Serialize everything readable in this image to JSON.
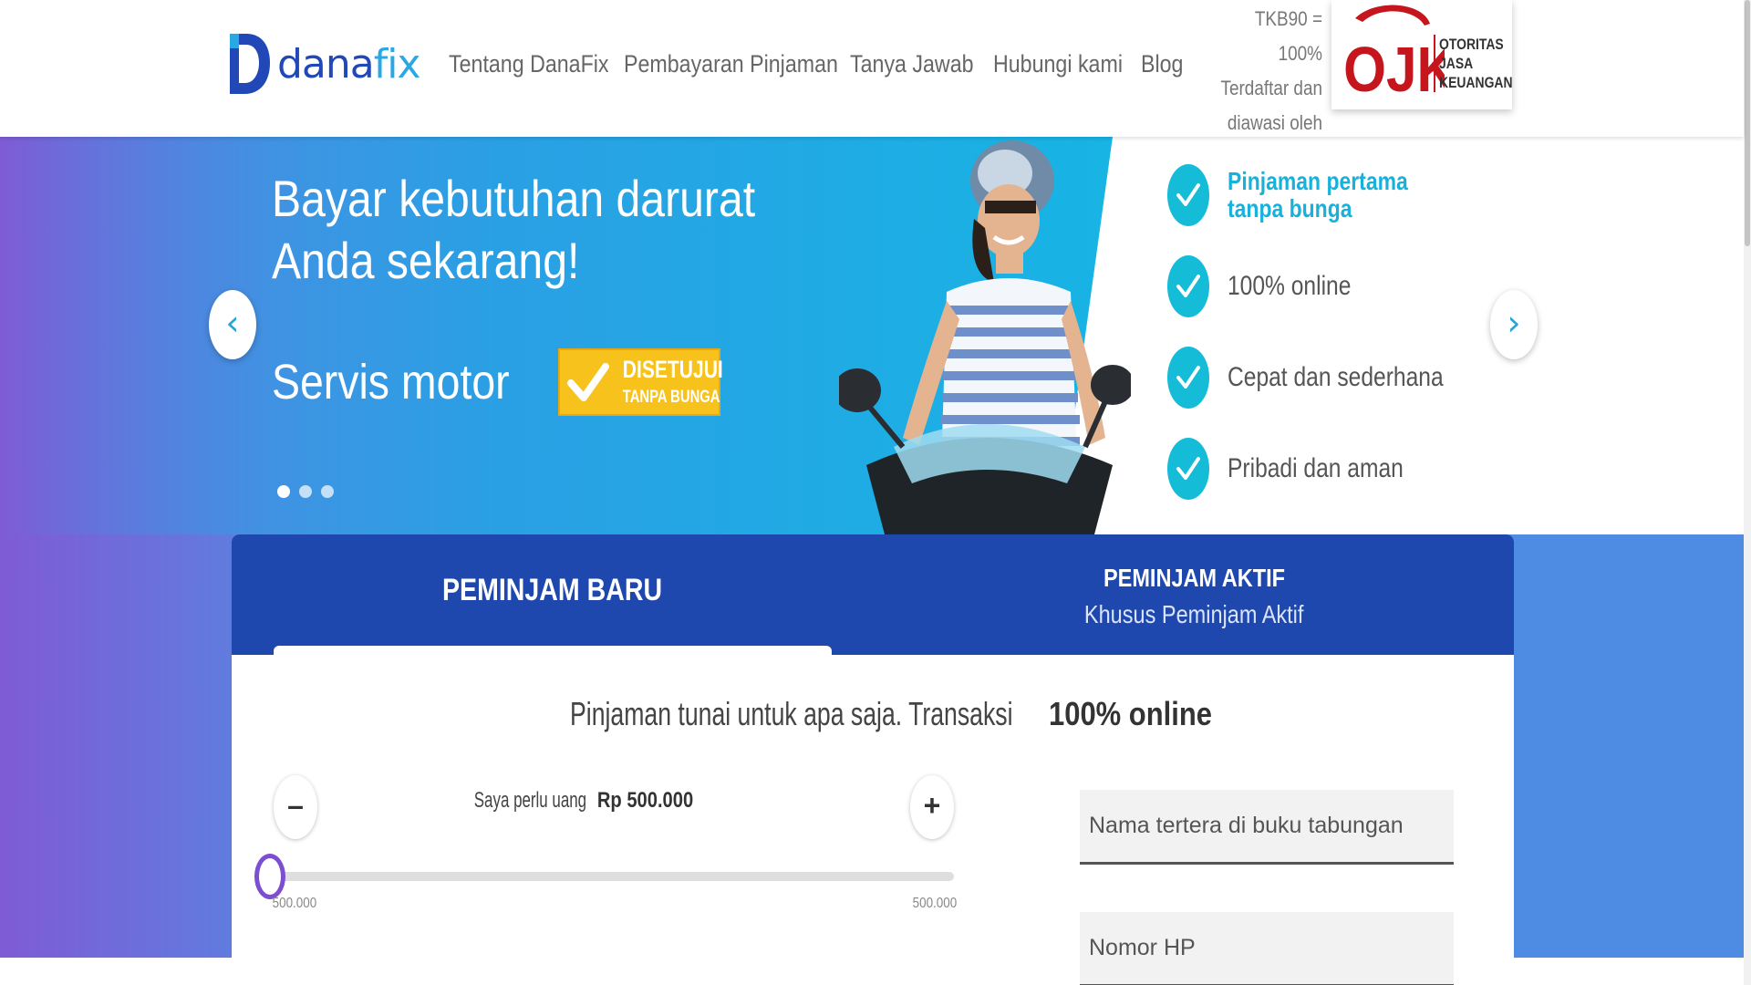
{
  "brand": {
    "logo_text_main": "dana",
    "logo_text_accent": "fix",
    "primary_color": "#1e48ad",
    "accent_color": "#17b1dc"
  },
  "nav": {
    "items": [
      "Tentang DanaFix",
      "Pembayaran Pinjaman",
      "Tanya Jawab",
      "Hubungi kami",
      "Blog"
    ]
  },
  "ojk": {
    "lines": [
      "TKB90 =",
      "100%",
      "Terdaftar dan",
      "diawasi oleh"
    ],
    "logo_letters": "OJK",
    "name_lines": [
      "OTORITAS",
      "JASA",
      "KEUANGAN"
    ]
  },
  "hero": {
    "title_lines": [
      "Bayar kebutuhan darurat",
      "Anda sekarang!"
    ],
    "subtitle": "Servis motor",
    "stamp_line1": "DISETUJUI",
    "stamp_line2": "TANPA BUNGA",
    "prev_icon": "‹",
    "next_icon": "›",
    "slide_count": 3,
    "active_slide": 1
  },
  "features": [
    {
      "label": "Pinjaman pertama tanpa bunga",
      "highlight": true
    },
    {
      "label": "100% online",
      "highlight": false
    },
    {
      "label": "Cepat dan sederhana",
      "highlight": false
    },
    {
      "label": "Pribadi dan aman",
      "highlight": false
    }
  ],
  "loan_card": {
    "tab_new": "PEMINJAM BARU",
    "tab_active_title": "PEMINJAM AKTIF",
    "tab_active_subtitle": "Khusus Peminjam Aktif",
    "headline_prefix": "Pinjaman tunai untuk apa saja. Transaksi ",
    "headline_bold": "100% online",
    "minus_label": "–",
    "plus_label": "+",
    "amount_prefix": "Saya perlu uang ",
    "amount_value": "Rp 500.000",
    "range_min": "500.000",
    "range_max": "500.000",
    "slider_fraction": 0,
    "name_placeholder": "Nama tertera di buku tabungan",
    "phone_placeholder": "Nomor HP"
  }
}
